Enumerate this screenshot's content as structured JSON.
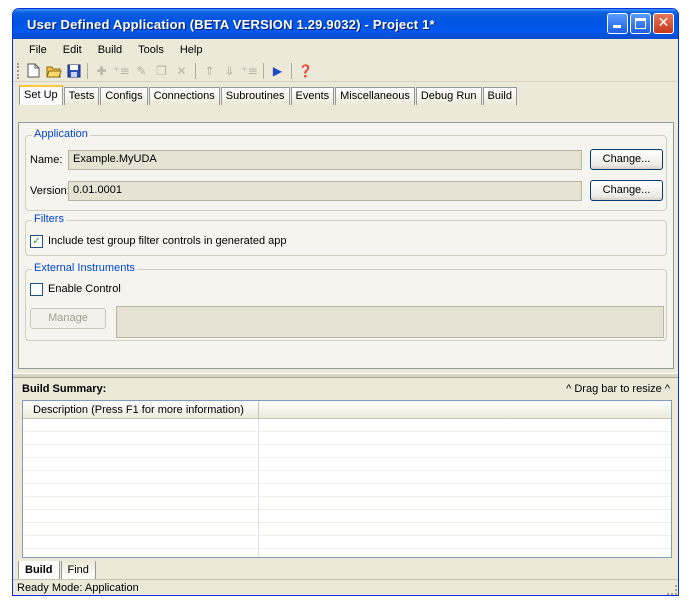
{
  "window": {
    "title": "User Defined Application (BETA VERSION 1.29.9032) - Project 1*"
  },
  "menu": [
    "File",
    "Edit",
    "Build",
    "Tools",
    "Help"
  ],
  "toolbar": {
    "icons": [
      "new-icon",
      "open-icon",
      "save-icon",
      "add-icon",
      "add-sub-icon",
      "edit-icon",
      "copy-icon",
      "delete-icon",
      "move-up-icon",
      "move-down-icon",
      "indent-icon",
      "run-icon",
      "help-icon"
    ]
  },
  "tabs": [
    "Set Up",
    "Tests",
    "Configs",
    "Connections",
    "Subroutines",
    "Events",
    "Miscellaneous",
    "Debug Run",
    "Build"
  ],
  "application": {
    "legend": "Application",
    "name_label": "Name:",
    "name_value": "Example.MyUDA",
    "version_label": "Version:",
    "version_value": "0.01.0001",
    "change_label": "Change..."
  },
  "filters": {
    "legend": "Filters",
    "checkbox_label": "Include test group filter controls in generated app",
    "checked": true
  },
  "external": {
    "legend": "External Instruments",
    "checkbox_label": "Enable Control",
    "checked": false,
    "manage_label": "Manage"
  },
  "summary": {
    "title": "Build Summary:",
    "hint": "^ Drag bar to resize ^",
    "column": "Description  (Press F1 for more information)"
  },
  "bottom_tabs": [
    "Build",
    "Find"
  ],
  "status": "Ready  Mode: Application",
  "colors": {
    "title_bar": "#0054e3",
    "legend": "#0046d5",
    "tab_highlight": "#ffc83c"
  }
}
